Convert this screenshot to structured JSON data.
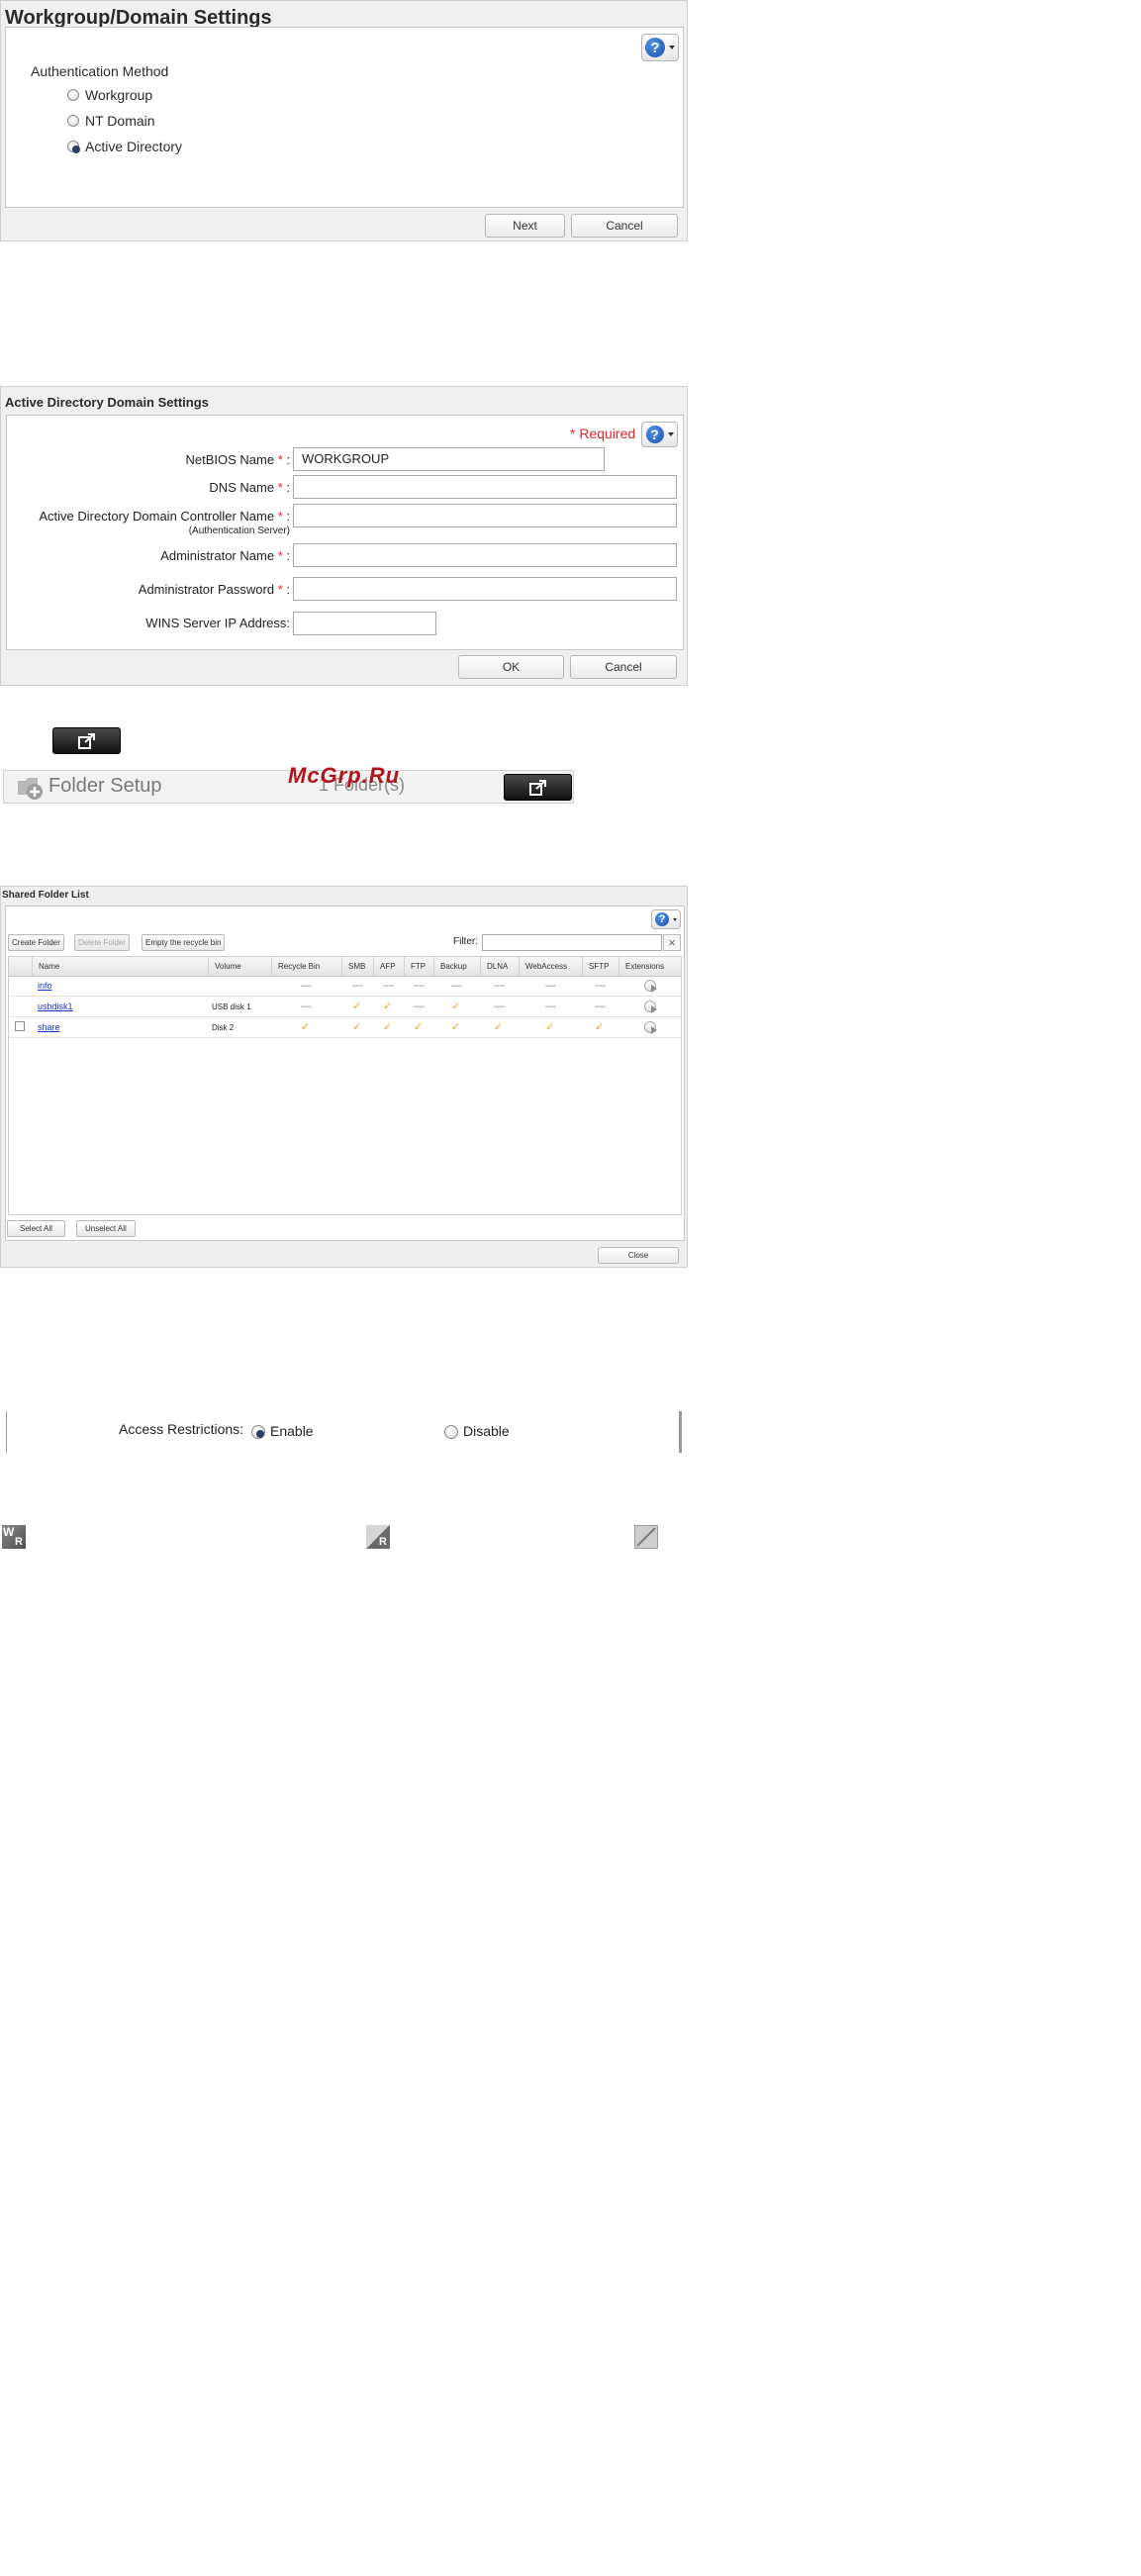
{
  "workgroup_panel": {
    "title": "Workgroup/Domain Settings",
    "auth_heading": "Authentication Method",
    "options": [
      {
        "label": "Workgroup",
        "selected": false
      },
      {
        "label": "NT Domain",
        "selected": false
      },
      {
        "label": "Active Directory",
        "selected": true
      }
    ],
    "next_label": "Next",
    "cancel_label": "Cancel"
  },
  "ad_panel": {
    "title": "Active Directory Domain Settings",
    "required_text": "* Required",
    "fields": [
      {
        "label": "NetBIOS Name",
        "required": true,
        "value": "WORKGROUP"
      },
      {
        "label": "DNS Name",
        "required": true,
        "value": ""
      },
      {
        "label": "Active Directory Domain Controller Name",
        "sublabel": "(Authentication Server)",
        "required": true,
        "value": ""
      },
      {
        "label": "Administrator Name",
        "required": true,
        "value": ""
      },
      {
        "label": "Administrator Password",
        "required": true,
        "value": ""
      },
      {
        "label": "WINS Server IP Address:",
        "required": false,
        "value": ""
      }
    ],
    "star": "*",
    "colon": ":",
    "ok_label": "OK",
    "cancel_label": "Cancel"
  },
  "folder_setup": {
    "title": "Folder Setup",
    "count": "1 Folder(s)"
  },
  "watermark": "McGrp.Ru",
  "shared_folder_list": {
    "title": "Shared Folder List",
    "buttons": {
      "create": "Create Folder",
      "delete": "Delete Folder",
      "empty": "Empty the recycle bin",
      "select_all": "Select All",
      "unselect_all": "Unselect All",
      "close": "Close"
    },
    "filter_label": "Filter:",
    "filter_value": "",
    "clear_glyph": "×",
    "columns": [
      "Name",
      "Volume",
      "Recycle Bin",
      "SMB",
      "AFP",
      "FTP",
      "Backup",
      "DLNA",
      "WebAccess",
      "SFTP",
      "Extensions"
    ],
    "rows": [
      {
        "name": "info",
        "volume": "",
        "checkbox": false,
        "flags": [
          "—",
          "—",
          "—",
          "—",
          "—",
          "—",
          "—",
          "—"
        ]
      },
      {
        "name": "usbdisk1",
        "volume": "USB disk 1",
        "checkbox": false,
        "flags": [
          "—",
          "✓",
          "✓",
          "—",
          "✓",
          "—",
          "—",
          "—"
        ]
      },
      {
        "name": "share",
        "volume": "Disk 2",
        "checkbox": true,
        "flags": [
          "✓",
          "✓",
          "✓",
          "✓",
          "✓",
          "✓",
          "✓",
          "✓"
        ]
      }
    ]
  },
  "access": {
    "label": "Access Restrictions:",
    "enable": "Enable",
    "disable": "Disable",
    "selected": "enable"
  },
  "icon_letters": {
    "w": "W",
    "r": "R"
  },
  "colors": {
    "check": "#f0a020",
    "required": "#e0252b",
    "link": "#1a35c9"
  }
}
